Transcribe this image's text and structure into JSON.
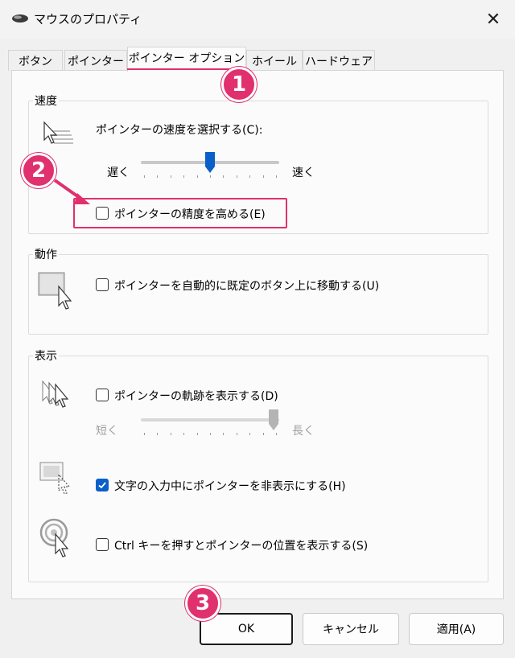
{
  "window": {
    "title": "マウスのプロパティ",
    "close_glyph": "✕"
  },
  "tabs": [
    {
      "label": "ボタン"
    },
    {
      "label": "ポインター"
    },
    {
      "label": "ポインター オプション"
    },
    {
      "label": "ホイール"
    },
    {
      "label": "ハードウェア"
    }
  ],
  "speed": {
    "legend": "速度",
    "select_label": "ポインターの速度を選択する(C):",
    "slow_label": "遅く",
    "fast_label": "速く",
    "slider_value": 0.5,
    "precision_label": "ポインターの精度を高める(E)",
    "precision_checked": false
  },
  "motion": {
    "legend": "動作",
    "snap_label": "ポインターを自動的に既定のボタン上に移動する(U)",
    "snap_checked": false
  },
  "visibility": {
    "legend": "表示",
    "trails_label": "ポインターの軌跡を表示する(D)",
    "trails_checked": false,
    "short_label": "短く",
    "long_label": "長く",
    "trail_value": 1.0,
    "hide_label": "文字の入力中にポインターを非表示にする(H)",
    "hide_checked": true,
    "ctrl_label": "Ctrl キーを押すとポインターの位置を表示する(S)",
    "ctrl_checked": false
  },
  "buttons": {
    "ok": "OK",
    "cancel": "キャンセル",
    "apply": "適用(A)"
  },
  "annotations": {
    "step1": "1",
    "step2": "2",
    "step3": "3"
  },
  "colors": {
    "accent": "#e0306e",
    "checkbox": "#0a5fc9"
  }
}
